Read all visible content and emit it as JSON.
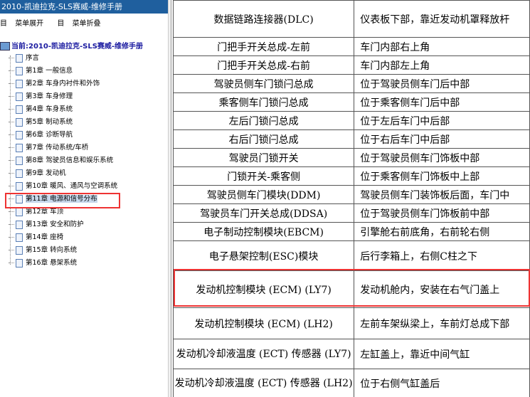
{
  "window": {
    "title": "2010-凯迪拉克-SLS赛威-维修手册"
  },
  "toolbar": {
    "expand": "菜单展开",
    "collapse": "菜单折叠",
    "expand_icon": "目",
    "collapse_icon": "目"
  },
  "current": {
    "label": "当前:2010-凯迪拉克-SLS赛威-维修手册"
  },
  "tree": [
    "序言",
    "第1章 一般信息",
    "第2章 车身内衬件和外饰",
    "第3章 车身修理",
    "第4章 车身系统",
    "第5章 制动系统",
    "第6章 诊断导航",
    "第7章 传动系统/车桥",
    "第8章 驾驶员信息和娱乐系统",
    "第9章 发动机",
    "第10章 暖风、通风与空调系统",
    "第11章 电源和信号分布",
    "第12章 车顶",
    "第13章 安全和防护",
    "第14章 座椅",
    "第15章 转向系统",
    "第16章 悬架系统"
  ],
  "selected_index": 11,
  "table": [
    {
      "component": "数据链路连接器(DLC)",
      "location": "仪表板下部，靠近发动机罩释放杆"
    },
    {
      "component": "门把手开关总成-左前",
      "location": "车门内部右上角"
    },
    {
      "component": "门把手开关总成-右前",
      "location": "车门内部左上角"
    },
    {
      "component": "驾驶员侧车门锁闩总成",
      "location": "位于驾驶员侧车门后中部"
    },
    {
      "component": "乘客侧车门锁闩总成",
      "location": "位于乘客侧车门后中部"
    },
    {
      "component": "左后门锁闩总成",
      "location": "位于左后车门中后部"
    },
    {
      "component": "右后门锁闩总成",
      "location": "位于右后车门中后部"
    },
    {
      "component": "驾驶员门锁开关",
      "location": "位于驾驶员侧车门饰板中部"
    },
    {
      "component": "门锁开关-乘客侧",
      "location": "位于乘客侧车门饰板中上部"
    },
    {
      "component": "驾驶员侧车门模块(DDM)",
      "location": "驾驶员侧车门装饰板后面，车门中"
    },
    {
      "component": "驾驶员车门开关总成(DDSA)",
      "location": "位于驾驶员侧车门饰板前中部"
    },
    {
      "component": "电子制动控制模块(EBCM)",
      "location": "引擎舱右前底角，右前轮右侧"
    },
    {
      "component": "电子悬架控制(ESC)模块",
      "location": "后行李箱上，右侧C柱之下"
    },
    {
      "component": "发动机控制模块 (ECM) (LY7)",
      "location": "发动机舱内，安装在右气门盖上"
    },
    {
      "component": "发动机控制模块 (ECM) (LH2)",
      "location": "左前车架纵梁上，车前灯总成下部"
    },
    {
      "component": "发动机冷却液温度 (ECT) 传感器 (LY7)",
      "location": "左缸盖上，靠近中间气缸"
    },
    {
      "component": "发动机冷却液温度 (ECT) 传感器 (LH2)",
      "location": "位于右侧气缸盖后"
    }
  ]
}
